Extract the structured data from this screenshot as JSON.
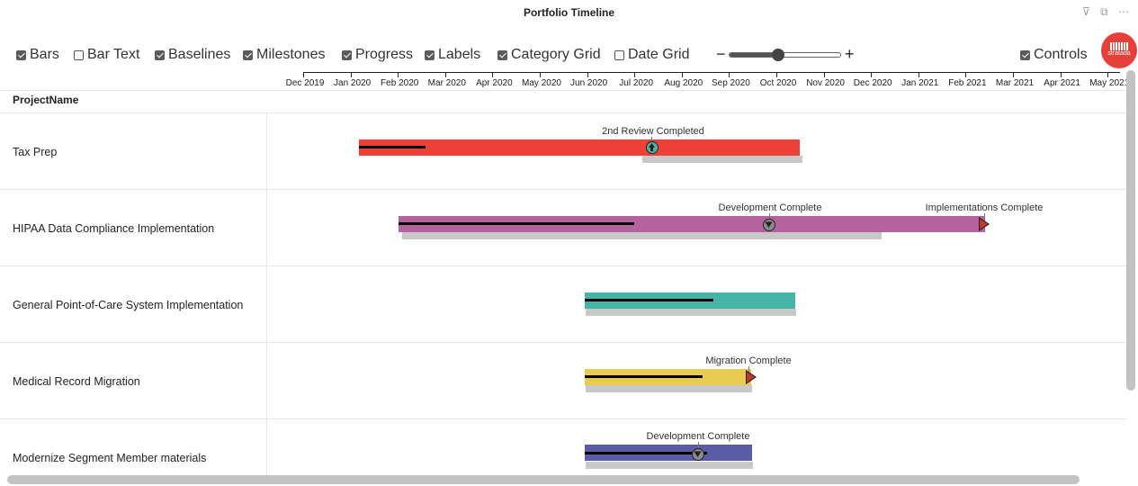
{
  "title": "Portfolio Timeline",
  "header_icons": [
    {
      "name": "filter-icon",
      "glyph": "⊽"
    },
    {
      "name": "focus-mode-icon",
      "glyph": "⧉"
    },
    {
      "name": "more-options-icon",
      "glyph": "⋯"
    }
  ],
  "toolbar": {
    "options": [
      {
        "label": "Bars",
        "checked": true
      },
      {
        "label": "Bar Text",
        "checked": false
      },
      {
        "label": "Baselines",
        "checked": true
      },
      {
        "label": "Milestones",
        "checked": true
      },
      {
        "label": "Progress",
        "checked": true
      },
      {
        "label": "Labels",
        "checked": true
      },
      {
        "label": "Category Grid",
        "checked": true
      },
      {
        "label": "Date Grid",
        "checked": false
      }
    ],
    "zoom_minus": "−",
    "zoom_plus": "+",
    "zoom_level": 0.45,
    "controls": {
      "label": "Controls",
      "checked": true
    },
    "logo_text": "stratada"
  },
  "axis": {
    "months": [
      "Dec 2019",
      "Jan 2020",
      "Feb 2020",
      "Mar 2020",
      "Apr 2020",
      "May 2020",
      "Jun 2020",
      "Jul 2020",
      "Aug 2020",
      "Sep 2020",
      "Oct 2020",
      "Nov 2020",
      "Dec 2020",
      "Jan 2021",
      "Feb 2021",
      "Mar 2021",
      "Apr 2021",
      "May 2021"
    ]
  },
  "column_header": "ProjectName",
  "rows": [
    {
      "name": "Tax Prep",
      "color": "#ee4036",
      "milestones": [
        {
          "label": "2nd Review Completed",
          "shape": "circle-up",
          "color": "#4bb5ad"
        }
      ]
    },
    {
      "name": "HIPAA Data Compliance Implementation",
      "color": "#b5639f",
      "milestones": [
        {
          "label": "Development Complete",
          "shape": "circle-down",
          "color": "#8a8a8a"
        },
        {
          "label": "Implementations Complete",
          "shape": "arrow",
          "color": "#c0392b"
        }
      ]
    },
    {
      "name": "General Point-of-Care System Implementation",
      "color": "#46b5a8",
      "milestones": []
    },
    {
      "name": "Medical Record Migration",
      "color": "#eacb52",
      "milestones": [
        {
          "label": "Migration Complete",
          "shape": "arrow",
          "color": "#c0392b"
        }
      ]
    },
    {
      "name": "Modernize Segment Member materials",
      "color": "#5a5ca6",
      "milestones": [
        {
          "label": "Development Complete",
          "shape": "circle-down",
          "color": "#8a8a8a"
        }
      ]
    }
  ]
}
